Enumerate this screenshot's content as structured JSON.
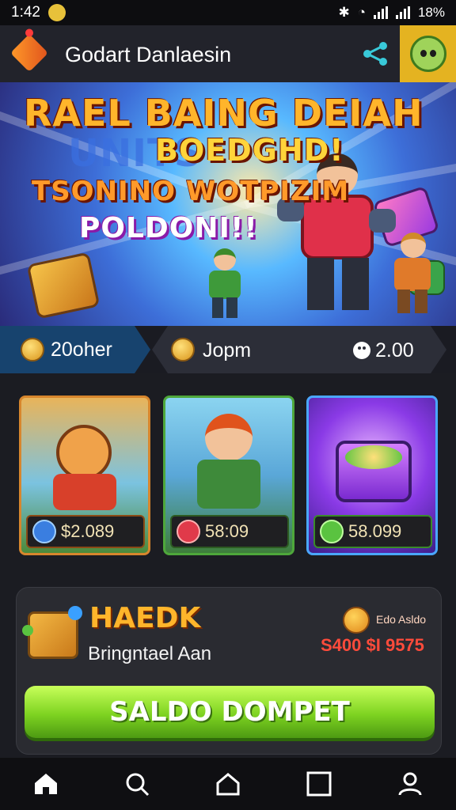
{
  "status_bar": {
    "time": "1:42",
    "battery": "18%"
  },
  "header": {
    "title": "Godart Danlaesin",
    "share_icon": "share-icon",
    "avatar_icon": "avatar"
  },
  "banner": {
    "line1": "RAEL BAING DEIAH",
    "line_bg": "UNITS",
    "line2": "BOEDGHD!",
    "line3": "TSONINO WOTPIZIM",
    "line4": "POLDONI!!"
  },
  "stats": [
    {
      "icon": "coin-icon",
      "label": "20oher"
    },
    {
      "icon": "coin-icon",
      "label": "Jopm"
    },
    {
      "icon": "gem-icon",
      "label": "2.00"
    }
  ],
  "cards": [
    {
      "name": "hero-card-fox",
      "price": "$2.089",
      "badge_color": "#3a7ee0"
    },
    {
      "name": "hero-card-soldier",
      "price": "58:09",
      "badge_color": "#e03a4a"
    },
    {
      "name": "hero-card-chest",
      "price": "58.099",
      "badge_color": "#5ac340"
    }
  ],
  "promo": {
    "title": "HAEDK",
    "subtitle": "Bringntael Aan",
    "small_label": "Edo Asldo",
    "amount": "S400 $I 9575",
    "button_label": "SALDO DOMPET"
  },
  "bottom_nav": [
    {
      "name": "home-icon"
    },
    {
      "name": "search-icon"
    },
    {
      "name": "house-icon"
    },
    {
      "name": "square-icon"
    },
    {
      "name": "profile-icon"
    }
  ],
  "colors": {
    "accent_green": "#7ed321",
    "accent_orange": "#ffb52b",
    "background": "#1b1c22"
  }
}
